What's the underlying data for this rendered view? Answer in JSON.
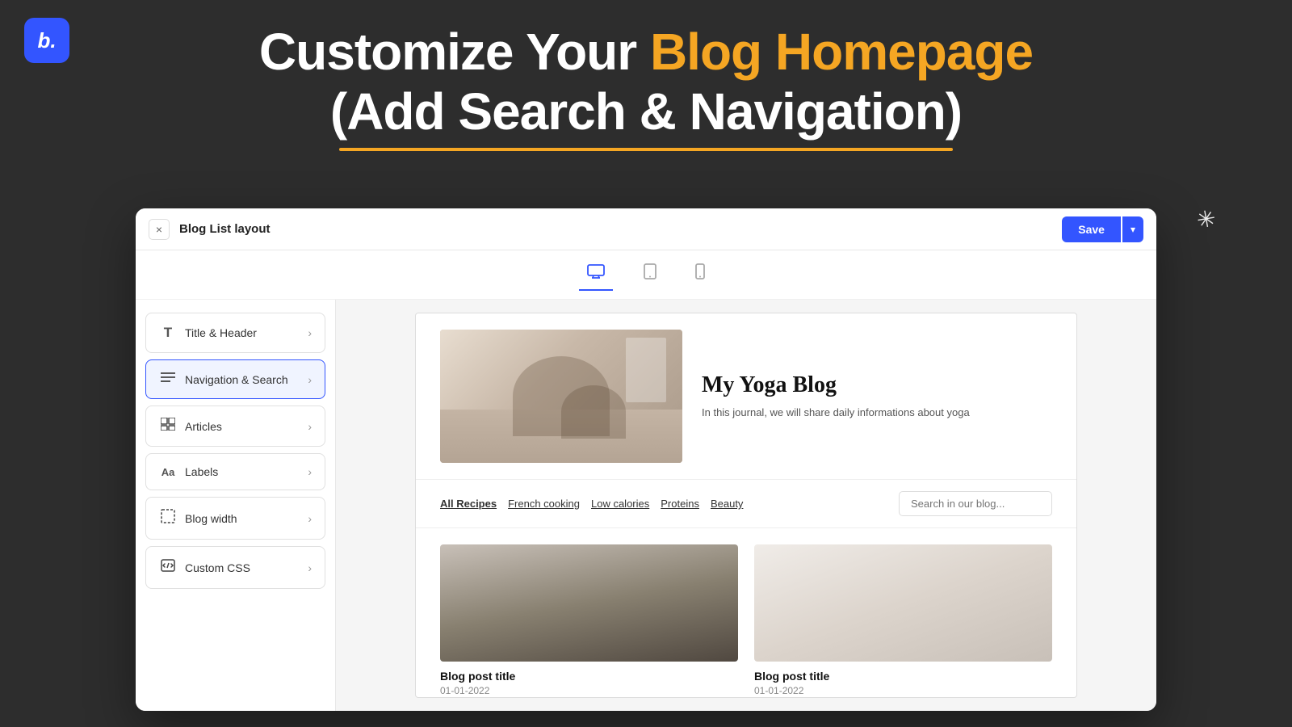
{
  "logo": {
    "text": "b."
  },
  "header": {
    "line1_normal": "Customize Your ",
    "line1_highlight": "Blog Homepage",
    "line2": "(Add Search & Navigation)"
  },
  "squiggle": "✻",
  "window": {
    "title": "Blog List layout",
    "close_label": "×",
    "save_label": "Save",
    "save_dropdown": "▾"
  },
  "devices": [
    {
      "icon": "🖥",
      "label": "desktop",
      "active": true
    },
    {
      "icon": "📱",
      "label": "tablet",
      "active": false
    },
    {
      "icon": "📱",
      "label": "mobile",
      "active": false
    }
  ],
  "panel_items": [
    {
      "icon": "T",
      "label": "Title & Header",
      "id": "title-header"
    },
    {
      "icon": "≡",
      "label": "Navigation & Search",
      "id": "nav-search",
      "highlighted": true
    },
    {
      "icon": "⊞",
      "label": "Articles",
      "id": "articles"
    },
    {
      "icon": "Aa",
      "label": "Labels",
      "id": "labels"
    },
    {
      "icon": "⤢",
      "label": "Blog width",
      "id": "blog-width"
    },
    {
      "icon": "◉",
      "label": "Custom CSS",
      "id": "custom-css"
    }
  ],
  "blog": {
    "hero_title": "My Yoga Blog",
    "hero_desc": "In this journal, we will share daily informations about yoga",
    "nav_tags": [
      "All Recipes",
      "French cooking",
      "Low calories",
      "Proteins",
      "Beauty"
    ],
    "search_placeholder": "Search in our blog...",
    "posts": [
      {
        "title": "Blog post title",
        "date": "01-01-2022",
        "image_type": "face"
      },
      {
        "title": "Blog post title",
        "date": "01-01-2022",
        "image_type": "spa"
      }
    ]
  },
  "colors": {
    "accent_blue": "#3355ff",
    "accent_gold": "#f5a623",
    "bg_dark": "#2d2d2d"
  }
}
